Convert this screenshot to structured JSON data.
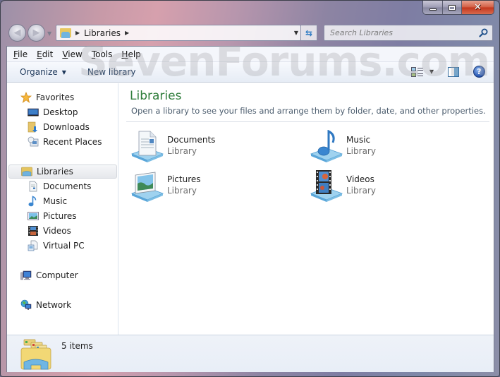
{
  "window": {
    "controls": {
      "minimize": "minimize",
      "maximize": "maximize",
      "close": "close"
    }
  },
  "address_bar": {
    "breadcrumbs": [
      "Libraries"
    ],
    "icon": "libraries-folder-icon"
  },
  "search": {
    "placeholder": "Search Libraries",
    "value": ""
  },
  "menubar": {
    "items": [
      {
        "label": "File",
        "mnemonic": "F",
        "rest": "ile"
      },
      {
        "label": "Edit",
        "mnemonic": "E",
        "rest": "dit"
      },
      {
        "label": "View",
        "mnemonic": "V",
        "rest": "iew"
      },
      {
        "label": "Tools",
        "mnemonic": "T",
        "rest": "ools"
      },
      {
        "label": "Help",
        "mnemonic": "H",
        "rest": "elp"
      }
    ]
  },
  "toolbar": {
    "organize_label": "Organize",
    "new_library_label": "New library"
  },
  "navpane": {
    "favorites": {
      "label": "Favorites",
      "items": [
        {
          "label": "Desktop",
          "icon": "desktop-icon"
        },
        {
          "label": "Downloads",
          "icon": "downloads-icon"
        },
        {
          "label": "Recent Places",
          "icon": "recent-places-icon"
        }
      ]
    },
    "libraries": {
      "label": "Libraries",
      "selected": true,
      "items": [
        {
          "label": "Documents",
          "icon": "documents-icon"
        },
        {
          "label": "Music",
          "icon": "music-icon"
        },
        {
          "label": "Pictures",
          "icon": "pictures-icon"
        },
        {
          "label": "Videos",
          "icon": "videos-icon"
        },
        {
          "label": "Virtual PC",
          "icon": "virtual-pc-icon"
        }
      ]
    },
    "computer": {
      "label": "Computer"
    },
    "network": {
      "label": "Network"
    }
  },
  "content": {
    "title": "Libraries",
    "subtitle": "Open a library to see your files and arrange them by folder, date, and other properties.",
    "libraries": [
      {
        "name": "Documents",
        "type": "Library",
        "icon": "documents-library-icon"
      },
      {
        "name": "Music",
        "type": "Library",
        "icon": "music-library-icon"
      },
      {
        "name": "Pictures",
        "type": "Library",
        "icon": "pictures-library-icon"
      },
      {
        "name": "Videos",
        "type": "Library",
        "icon": "videos-library-icon"
      }
    ]
  },
  "details": {
    "item_count": "5 items"
  },
  "watermark": "SevenForums.com",
  "colors": {
    "title_accent": "#2f7d3b",
    "toolbar_text": "#1e395b",
    "close_button": "#c2351c"
  }
}
